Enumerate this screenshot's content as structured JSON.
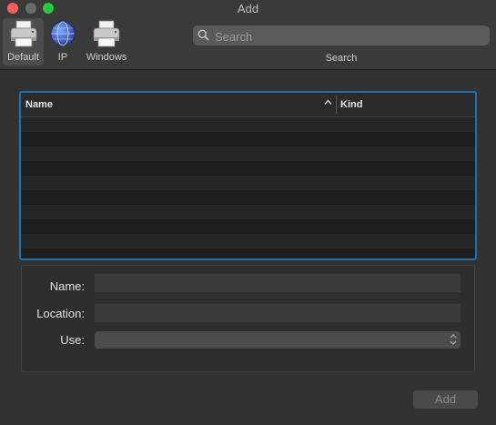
{
  "window": {
    "title": "Add"
  },
  "toolbar": {
    "tabs": [
      {
        "label": "Default",
        "icon": "printer-icon",
        "selected": true
      },
      {
        "label": "IP",
        "icon": "globe-icon",
        "selected": false
      },
      {
        "label": "Windows",
        "icon": "printer-icon",
        "selected": false
      }
    ],
    "search": {
      "placeholder": "Search",
      "value": "",
      "label": "Search"
    }
  },
  "table": {
    "columns": [
      {
        "label": "Name",
        "sorted": "ascending"
      },
      {
        "label": "Kind"
      }
    ],
    "rows": []
  },
  "form": {
    "name_label": "Name:",
    "name_value": "",
    "location_label": "Location:",
    "location_value": "",
    "use_label": "Use:",
    "use_value": ""
  },
  "buttons": {
    "add_label": "Add",
    "add_enabled": false
  },
  "colors": {
    "accent": "#1e6fb3",
    "close": "#ff5f57",
    "zoom": "#28c940"
  }
}
